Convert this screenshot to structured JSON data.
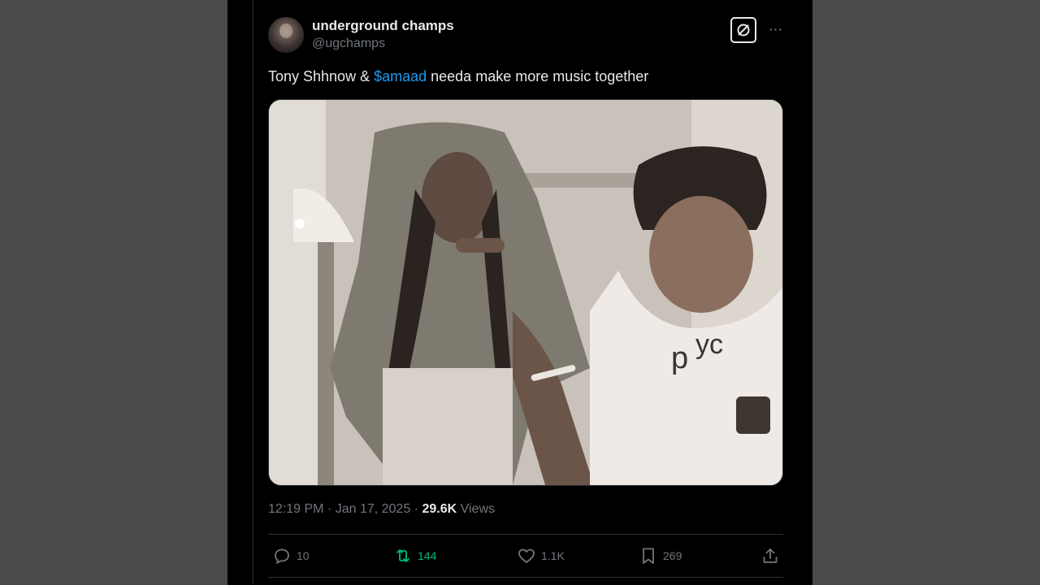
{
  "tweet": {
    "author": {
      "display_name": "underground champs",
      "handle": "@ugchamps",
      "avatar_icon": "profile-avatar"
    },
    "text_before": "Tony Shhnow & ",
    "cashtag": "$amaad",
    "text_after": " needa make more music together",
    "media": {
      "type": "photo",
      "icon": "photo"
    },
    "timestamp": "12:19 PM · Jan 17, 2025",
    "views_separator": " · ",
    "views_count": "29.6K",
    "views_label": " Views",
    "actions": {
      "reply": {
        "icon": "reply-icon",
        "count": "10"
      },
      "retweet": {
        "icon": "retweet-icon",
        "count": "144",
        "color": "#00ba7c"
      },
      "like": {
        "icon": "heart-icon",
        "count": "1.1K"
      },
      "bookmark": {
        "icon": "bookmark-icon",
        "count": "269"
      },
      "share": {
        "icon": "share-icon"
      }
    }
  },
  "colors": {
    "background": "#000000",
    "text": "#e7e9ea",
    "muted": "#71767b",
    "link": "#1d9bf0",
    "page_bg": "#4a4a4a"
  }
}
